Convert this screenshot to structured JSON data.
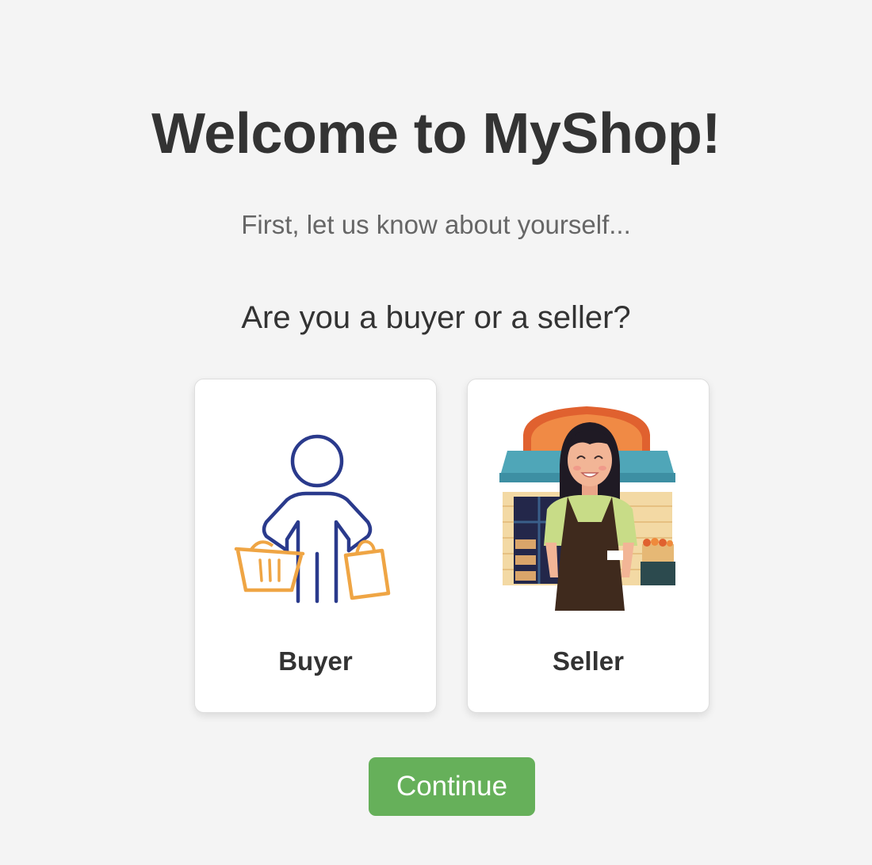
{
  "header": {
    "title": "Welcome to MyShop!",
    "subtitle": "First, let us know about yourself...",
    "question": "Are you a buyer or a seller?"
  },
  "options": [
    {
      "label": "Buyer",
      "icon": "shopper-with-basket-and-bag-icon"
    },
    {
      "label": "Seller",
      "icon": "shopkeeper-in-front-of-store-icon"
    }
  ],
  "actions": {
    "continue_label": "Continue"
  },
  "colors": {
    "background": "#f4f4f4",
    "primary_button": "#66b05a",
    "buyer_figure": "#2a3a8c",
    "buyer_accent": "#efa544",
    "store_sign": "#e0612f",
    "awning": "#4fa6b8",
    "apron": "#3f2a1d",
    "shirt": "#c8dc87"
  }
}
